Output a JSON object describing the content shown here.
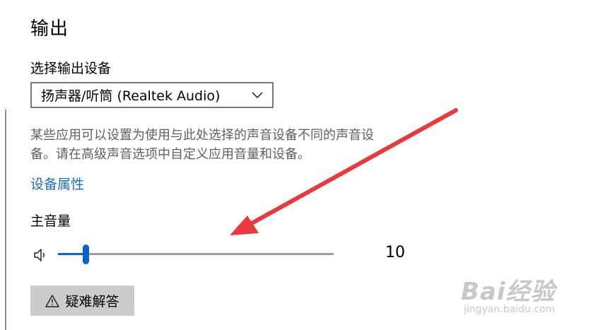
{
  "section": {
    "title": "输出"
  },
  "output_device": {
    "label": "选择输出设备",
    "selected": "扬声器/听筒 (Realtek Audio)"
  },
  "description": {
    "line1": "某些应用可以设置为使用与此处选择的声音设备不同的声音设",
    "line2": "备。请在高级声音选项中自定义应用音量和设备。"
  },
  "device_properties_link": "设备属性",
  "master_volume": {
    "label": "主音量",
    "value": 10,
    "value_text": "10",
    "max": 100
  },
  "troubleshoot_button": {
    "label": "疑难解答",
    "icon": "warning-icon"
  },
  "annotation": {
    "type": "red-arrow",
    "color": "#e8393c"
  },
  "watermark": {
    "main": "Bai经验",
    "sub": "jingyan.baidu.com"
  },
  "colors": {
    "accent": "#0a63c7",
    "link": "#1a6fb5",
    "description_text": "#606060",
    "button_bg": "#cccccc"
  }
}
